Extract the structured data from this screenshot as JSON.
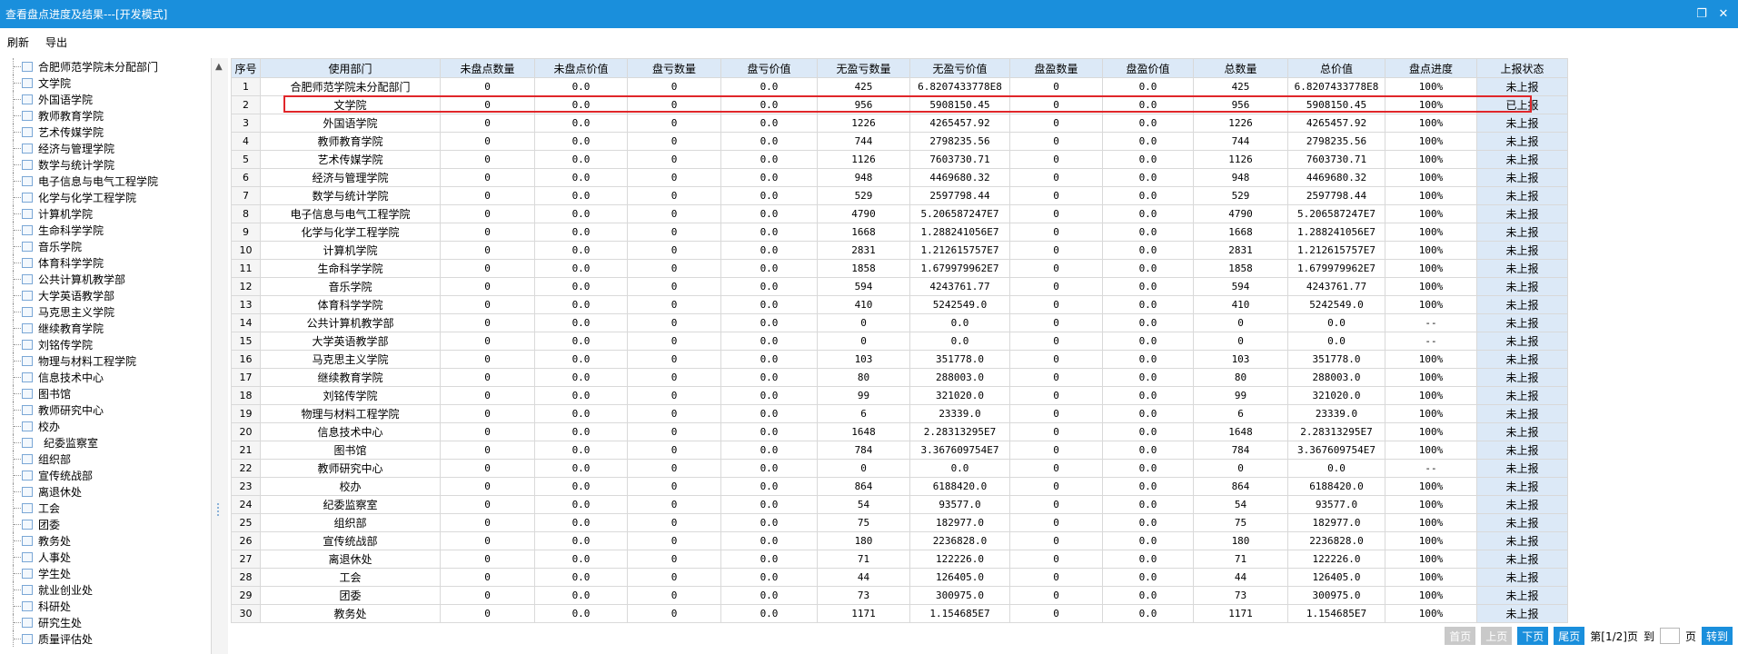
{
  "window": {
    "title": "查看盘点进度及结果---[开发模式]"
  },
  "toolbar": {
    "refresh": "刷新",
    "export": "导出"
  },
  "tree": {
    "items": [
      "合肥师范学院未分配部门",
      "文学院",
      "外国语学院",
      "教师教育学院",
      "艺术传媒学院",
      "经济与管理学院",
      "数学与统计学院",
      "电子信息与电气工程学院",
      "化学与化学工程学院",
      "计算机学院",
      "生命科学学院",
      "音乐学院",
      "体育科学学院",
      "公共计算机教学部",
      "大学英语教学部",
      "马克思主义学院",
      "继续教育学院",
      "刘铭传学院",
      "物理与材料工程学院",
      "信息技术中心",
      "图书馆",
      "教师研究中心",
      "校办",
      "纪委监察室",
      "组织部",
      "宣传统战部",
      "离退休处",
      "工会",
      "团委",
      "教务处",
      "人事处",
      "学生处",
      "就业创业处",
      "科研处",
      "研究生处",
      "质量评估处"
    ]
  },
  "table": {
    "columns": [
      "序号",
      "使用部门",
      "未盘点数量",
      "未盘点价值",
      "盘亏数量",
      "盘亏价值",
      "无盈亏数量",
      "无盈亏价值",
      "盘盈数量",
      "盘盈价值",
      "总数量",
      "总价值",
      "盘点进度",
      "上报状态"
    ],
    "rows": [
      [
        "1",
        "合肥师范学院未分配部门",
        "0",
        "0.0",
        "0",
        "0.0",
        "425",
        "6.8207433778E8",
        "0",
        "0.0",
        "425",
        "6.8207433778E8",
        "100%",
        "未上报"
      ],
      [
        "2",
        "文学院",
        "0",
        "0.0",
        "0",
        "0.0",
        "956",
        "5908150.45",
        "0",
        "0.0",
        "956",
        "5908150.45",
        "100%",
        "已上报"
      ],
      [
        "3",
        "外国语学院",
        "0",
        "0.0",
        "0",
        "0.0",
        "1226",
        "4265457.92",
        "0",
        "0.0",
        "1226",
        "4265457.92",
        "100%",
        "未上报"
      ],
      [
        "4",
        "教师教育学院",
        "0",
        "0.0",
        "0",
        "0.0",
        "744",
        "2798235.56",
        "0",
        "0.0",
        "744",
        "2798235.56",
        "100%",
        "未上报"
      ],
      [
        "5",
        "艺术传媒学院",
        "0",
        "0.0",
        "0",
        "0.0",
        "1126",
        "7603730.71",
        "0",
        "0.0",
        "1126",
        "7603730.71",
        "100%",
        "未上报"
      ],
      [
        "6",
        "经济与管理学院",
        "0",
        "0.0",
        "0",
        "0.0",
        "948",
        "4469680.32",
        "0",
        "0.0",
        "948",
        "4469680.32",
        "100%",
        "未上报"
      ],
      [
        "7",
        "数学与统计学院",
        "0",
        "0.0",
        "0",
        "0.0",
        "529",
        "2597798.44",
        "0",
        "0.0",
        "529",
        "2597798.44",
        "100%",
        "未上报"
      ],
      [
        "8",
        "电子信息与电气工程学院",
        "0",
        "0.0",
        "0",
        "0.0",
        "4790",
        "5.206587247E7",
        "0",
        "0.0",
        "4790",
        "5.206587247E7",
        "100%",
        "未上报"
      ],
      [
        "9",
        "化学与化学工程学院",
        "0",
        "0.0",
        "0",
        "0.0",
        "1668",
        "1.288241056E7",
        "0",
        "0.0",
        "1668",
        "1.288241056E7",
        "100%",
        "未上报"
      ],
      [
        "10",
        "计算机学院",
        "0",
        "0.0",
        "0",
        "0.0",
        "2831",
        "1.212615757E7",
        "0",
        "0.0",
        "2831",
        "1.212615757E7",
        "100%",
        "未上报"
      ],
      [
        "11",
        "生命科学学院",
        "0",
        "0.0",
        "0",
        "0.0",
        "1858",
        "1.679979962E7",
        "0",
        "0.0",
        "1858",
        "1.679979962E7",
        "100%",
        "未上报"
      ],
      [
        "12",
        "音乐学院",
        "0",
        "0.0",
        "0",
        "0.0",
        "594",
        "4243761.77",
        "0",
        "0.0",
        "594",
        "4243761.77",
        "100%",
        "未上报"
      ],
      [
        "13",
        "体育科学学院",
        "0",
        "0.0",
        "0",
        "0.0",
        "410",
        "5242549.0",
        "0",
        "0.0",
        "410",
        "5242549.0",
        "100%",
        "未上报"
      ],
      [
        "14",
        "公共计算机教学部",
        "0",
        "0.0",
        "0",
        "0.0",
        "0",
        "0.0",
        "0",
        "0.0",
        "0",
        "0.0",
        "--",
        "未上报"
      ],
      [
        "15",
        "大学英语教学部",
        "0",
        "0.0",
        "0",
        "0.0",
        "0",
        "0.0",
        "0",
        "0.0",
        "0",
        "0.0",
        "--",
        "未上报"
      ],
      [
        "16",
        "马克思主义学院",
        "0",
        "0.0",
        "0",
        "0.0",
        "103",
        "351778.0",
        "0",
        "0.0",
        "103",
        "351778.0",
        "100%",
        "未上报"
      ],
      [
        "17",
        "继续教育学院",
        "0",
        "0.0",
        "0",
        "0.0",
        "80",
        "288003.0",
        "0",
        "0.0",
        "80",
        "288003.0",
        "100%",
        "未上报"
      ],
      [
        "18",
        "刘铭传学院",
        "0",
        "0.0",
        "0",
        "0.0",
        "99",
        "321020.0",
        "0",
        "0.0",
        "99",
        "321020.0",
        "100%",
        "未上报"
      ],
      [
        "19",
        "物理与材料工程学院",
        "0",
        "0.0",
        "0",
        "0.0",
        "6",
        "23339.0",
        "0",
        "0.0",
        "6",
        "23339.0",
        "100%",
        "未上报"
      ],
      [
        "20",
        "信息技术中心",
        "0",
        "0.0",
        "0",
        "0.0",
        "1648",
        "2.28313295E7",
        "0",
        "0.0",
        "1648",
        "2.28313295E7",
        "100%",
        "未上报"
      ],
      [
        "21",
        "图书馆",
        "0",
        "0.0",
        "0",
        "0.0",
        "784",
        "3.367609754E7",
        "0",
        "0.0",
        "784",
        "3.367609754E7",
        "100%",
        "未上报"
      ],
      [
        "22",
        "教师研究中心",
        "0",
        "0.0",
        "0",
        "0.0",
        "0",
        "0.0",
        "0",
        "0.0",
        "0",
        "0.0",
        "--",
        "未上报"
      ],
      [
        "23",
        "校办",
        "0",
        "0.0",
        "0",
        "0.0",
        "864",
        "6188420.0",
        "0",
        "0.0",
        "864",
        "6188420.0",
        "100%",
        "未上报"
      ],
      [
        "24",
        "纪委监察室",
        "0",
        "0.0",
        "0",
        "0.0",
        "54",
        "93577.0",
        "0",
        "0.0",
        "54",
        "93577.0",
        "100%",
        "未上报"
      ],
      [
        "25",
        "组织部",
        "0",
        "0.0",
        "0",
        "0.0",
        "75",
        "182977.0",
        "0",
        "0.0",
        "75",
        "182977.0",
        "100%",
        "未上报"
      ],
      [
        "26",
        "宣传统战部",
        "0",
        "0.0",
        "0",
        "0.0",
        "180",
        "2236828.0",
        "0",
        "0.0",
        "180",
        "2236828.0",
        "100%",
        "未上报"
      ],
      [
        "27",
        "离退休处",
        "0",
        "0.0",
        "0",
        "0.0",
        "71",
        "122226.0",
        "0",
        "0.0",
        "71",
        "122226.0",
        "100%",
        "未上报"
      ],
      [
        "28",
        "工会",
        "0",
        "0.0",
        "0",
        "0.0",
        "44",
        "126405.0",
        "0",
        "0.0",
        "44",
        "126405.0",
        "100%",
        "未上报"
      ],
      [
        "29",
        "团委",
        "0",
        "0.0",
        "0",
        "0.0",
        "73",
        "300975.0",
        "0",
        "0.0",
        "73",
        "300975.0",
        "100%",
        "未上报"
      ],
      [
        "30",
        "教务处",
        "0",
        "0.0",
        "0",
        "0.0",
        "1171",
        "1.154685E7",
        "0",
        "0.0",
        "1171",
        "1.154685E7",
        "100%",
        "未上报"
      ]
    ]
  },
  "pager": {
    "first": "首页",
    "prev": "上页",
    "next": "下页",
    "last": "尾页",
    "page_info": "第[1/2]页",
    "to": "到",
    "page_unit": "页",
    "go": "转到"
  },
  "colors": {
    "accent": "#1a8fdc",
    "header_bg": "#dce9f7",
    "highlight": "#e0262a"
  },
  "icons": {
    "window_restore": "restore-icon",
    "window_close": "close-icon"
  }
}
